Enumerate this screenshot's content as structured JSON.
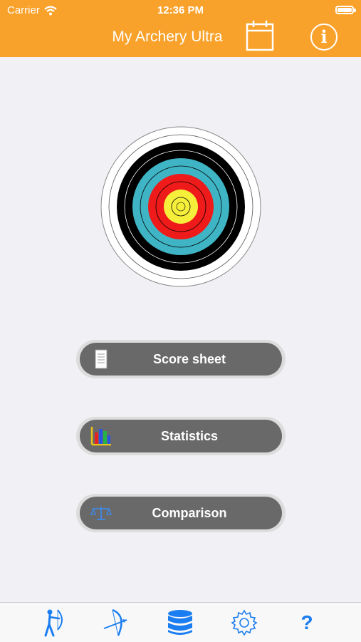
{
  "status_bar": {
    "carrier": "Carrier",
    "time": "12:36 PM"
  },
  "header": {
    "title": "My Archery Ultra",
    "calendar_icon": "calendar-icon",
    "info_icon": "info-icon",
    "info_glyph": "i"
  },
  "menu": {
    "score_sheet": {
      "label": "Score sheet",
      "icon": "document-icon"
    },
    "statistics": {
      "label": "Statistics",
      "icon": "bar-chart-icon"
    },
    "comparison": {
      "label": "Comparison",
      "icon": "scales-icon"
    }
  },
  "tab_bar": {
    "items": [
      {
        "icon": "archer-icon"
      },
      {
        "icon": "bow-icon"
      },
      {
        "icon": "database-icon"
      },
      {
        "icon": "gear-icon"
      },
      {
        "icon": "help-icon",
        "glyph": "?"
      }
    ]
  },
  "colors": {
    "header": "#f9a22b",
    "button": "#696969",
    "tab_tint": "#1a7df0",
    "background": "#f1f1f5"
  }
}
